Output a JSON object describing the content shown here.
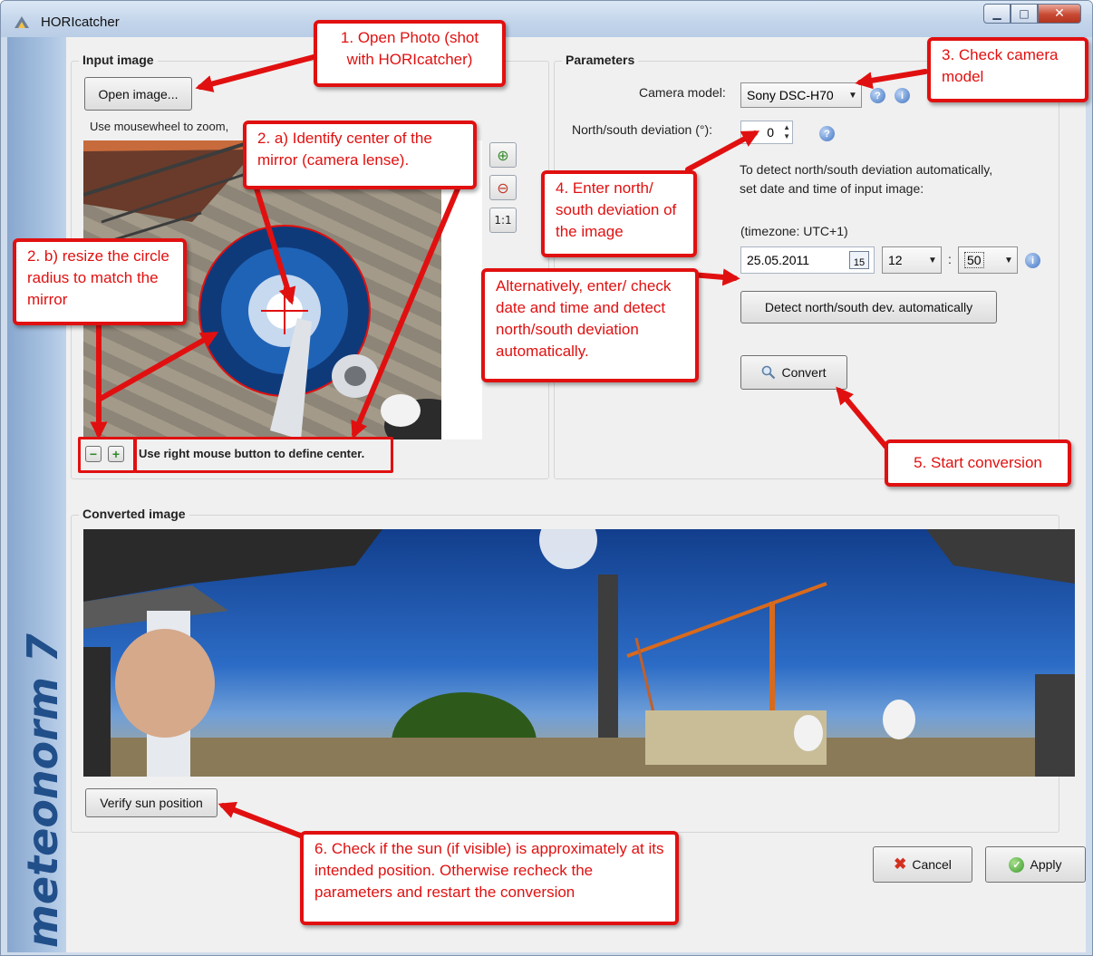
{
  "window": {
    "title": "HORIcatcher",
    "minimize_glyph": "▁",
    "maximize_glyph": "□",
    "close_glyph": "✕"
  },
  "brand": {
    "text": "meteonorm 7"
  },
  "input_image": {
    "group_title": "Input image",
    "open_button": "Open image...",
    "zoom_hint": "Use mousewheel to zoom,",
    "zoom_in_glyph": "⊕",
    "zoom_out_glyph": "⊖",
    "zoom_reset_label": "1:1",
    "radius_minus": "−",
    "radius_plus": "+",
    "center_hint": "Use right mouse button to define center."
  },
  "parameters": {
    "group_title": "Parameters",
    "camera_model_label": "Camera model:",
    "camera_model_value": "Sony DSC-H70",
    "deviation_label": "North/south deviation (°):",
    "deviation_value": "0",
    "auto_hint": "To detect north/south deviation automatically, set date and time of input image:",
    "timezone": "(timezone: UTC+1)",
    "date_value": "25.05.2011",
    "calendar_day": "15",
    "hour_value": "12",
    "time_separator": ":",
    "minute_value": "50",
    "detect_button": "Detect north/south dev. automatically",
    "convert_button": "Convert"
  },
  "converted_image": {
    "group_title": "Converted image",
    "verify_button": "Verify sun position"
  },
  "footer": {
    "cancel_button": "Cancel",
    "apply_button": "Apply"
  },
  "callouts": {
    "step1": "1. Open Photo (shot with HORIcatcher)",
    "step2a": "2. a) Identify center of the mirror (camera lense).",
    "step2b": "2. b) resize the circle radius to match the mirror",
    "step3": "3. Check camera model",
    "step4": "4. Enter north/ south deviation of the image",
    "alternative": "Alternatively, enter/ check date and time and detect north/south deviation automatically.",
    "step5": "5. Start conversion",
    "step6": "6. Check if the sun (if visible) is approximately at its intended position. Otherwise recheck the parameters and restart the conversion"
  },
  "colors": {
    "annotation_red": "#e11010",
    "brand_blue": "#214f8a",
    "sky_blue": "#1f4f9e"
  },
  "icons": [
    "app-icon",
    "zoom-in-icon",
    "zoom-out-icon",
    "help-icon",
    "info-icon",
    "calendar-icon",
    "magnifier-icon",
    "cancel-x-icon",
    "apply-check-icon"
  ]
}
